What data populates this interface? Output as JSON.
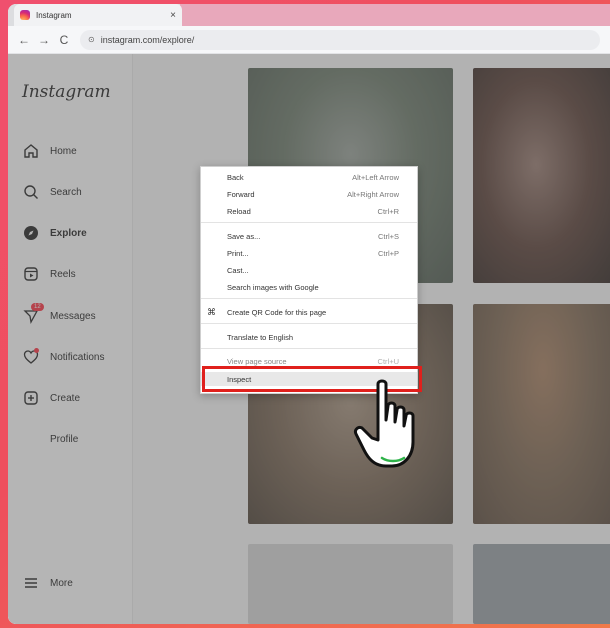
{
  "browser": {
    "tab_title": "Instagram",
    "tab_close": "×",
    "url": "instagram.com/explore/",
    "nav_back": "←",
    "nav_forward": "→",
    "nav_reload": "C"
  },
  "sidebar": {
    "logo": "Instagram",
    "items": [
      {
        "label": "Home",
        "icon": "home-icon"
      },
      {
        "label": "Search",
        "icon": "search-icon"
      },
      {
        "label": "Explore",
        "icon": "compass-icon"
      },
      {
        "label": "Reels",
        "icon": "reels-icon"
      },
      {
        "label": "Messages",
        "icon": "messenger-icon",
        "badge": "12"
      },
      {
        "label": "Notifications",
        "icon": "heart-icon"
      },
      {
        "label": "Create",
        "icon": "plus-square-icon"
      },
      {
        "label": "Profile",
        "icon": "avatar"
      },
      {
        "label": "More",
        "icon": "menu-icon"
      }
    ]
  },
  "context_menu": {
    "back": {
      "label": "Back",
      "shortcut": "Alt+Left Arrow"
    },
    "forward": {
      "label": "Forward",
      "shortcut": "Alt+Right Arrow"
    },
    "reload": {
      "label": "Reload",
      "shortcut": "Ctrl+R"
    },
    "save_as": {
      "label": "Save as...",
      "shortcut": "Ctrl+S"
    },
    "print": {
      "label": "Print...",
      "shortcut": "Ctrl+P"
    },
    "cast": {
      "label": "Cast..."
    },
    "search_images": {
      "label": "Search images with Google"
    },
    "qr_code": {
      "label": "Create QR Code for this page"
    },
    "translate": {
      "label": "Translate to English"
    },
    "view_source": {
      "label": "View page source",
      "shortcut": "Ctrl+U"
    },
    "inspect": {
      "label": "Inspect"
    }
  },
  "colors": {
    "highlight_border": "#e0201c",
    "badge": "#ff3040"
  }
}
